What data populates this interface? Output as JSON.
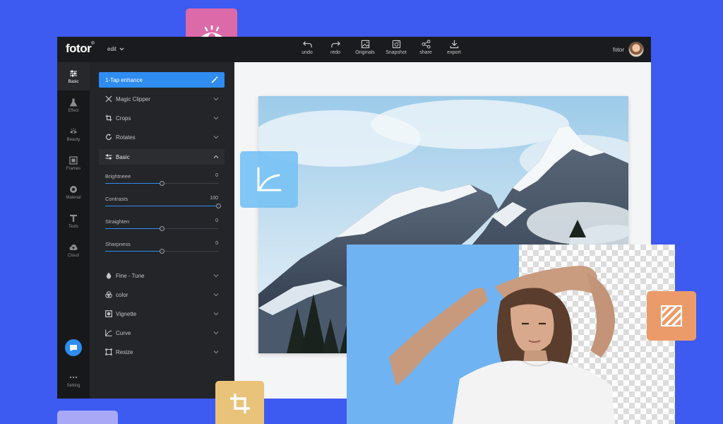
{
  "app": {
    "logo": "fotor",
    "logo_mark": "®",
    "edit_menu": "edit",
    "user_name": "fotor"
  },
  "toolbar": [
    {
      "label": "undo",
      "icon": "undo-icon"
    },
    {
      "label": "redo",
      "icon": "redo-icon"
    },
    {
      "label": "Originals",
      "icon": "image-icon"
    },
    {
      "label": "Snapshot",
      "icon": "camera-icon"
    },
    {
      "label": "share",
      "icon": "share-icon"
    },
    {
      "label": "export",
      "icon": "download-icon"
    }
  ],
  "rail": [
    {
      "label": "Basic",
      "icon": "sliders-icon",
      "active": true
    },
    {
      "label": "Effect",
      "icon": "flask-icon"
    },
    {
      "label": "Beauty",
      "icon": "eye-icon"
    },
    {
      "label": "Frames",
      "icon": "frame-icon"
    },
    {
      "label": "Material",
      "icon": "flower-icon"
    },
    {
      "label": "Texts",
      "icon": "text-icon"
    },
    {
      "label": "Cloud",
      "icon": "cloud-icon"
    },
    {
      "label": "Setting",
      "icon": "more-icon"
    }
  ],
  "panel": {
    "enhance_label": "1-Tap enhance",
    "sections_top": [
      {
        "label": "Magic Clipper",
        "icon": "scissors-icon"
      },
      {
        "label": "Crops",
        "icon": "crop-icon"
      },
      {
        "label": "Rotates",
        "icon": "rotate-icon"
      }
    ],
    "basic_label": "Basic",
    "sliders": [
      {
        "label": "Brightneee",
        "value": "0",
        "level": 0.5
      },
      {
        "label": "Contrasts",
        "value": "100",
        "level": 1.0
      },
      {
        "label": "Straighten",
        "value": "0",
        "level": 0.5
      },
      {
        "label": "Sharpness",
        "value": "0",
        "level": 0.5
      }
    ],
    "sections_bottom": [
      {
        "label": "Fine - Tune",
        "icon": "drop-icon"
      },
      {
        "label": "color",
        "icon": "palette-icon"
      },
      {
        "label": "Vignette",
        "icon": "vignette-icon"
      },
      {
        "label": "Curve",
        "icon": "curve-icon"
      },
      {
        "label": "Resize",
        "icon": "resize-icon"
      }
    ]
  },
  "colors": {
    "accent": "#2f8cf0",
    "background": "#3d5af1"
  }
}
